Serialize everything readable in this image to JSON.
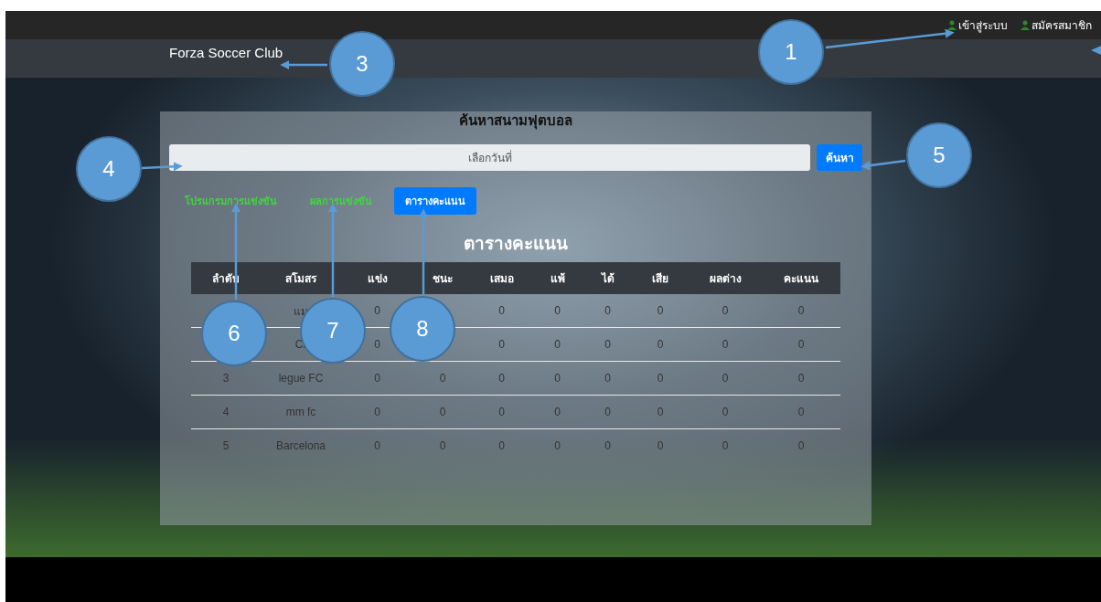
{
  "top_bar": {
    "links": [
      {
        "label": "เข้าสู่ระบบ"
      },
      {
        "label": "สมัครสมาชิก"
      }
    ]
  },
  "navbar": {
    "brand": "Forza Soccer Club"
  },
  "search_panel": {
    "title": "ค้นหาสนามฟุตบอล",
    "date_field": {
      "placeholder": "เลือกวันที่"
    },
    "search_button": "ค้นหา"
  },
  "tabs": [
    {
      "label": "โปรแกรมการแข่งขัน",
      "selected": false
    },
    {
      "label": "ผลการแข่งขัน",
      "selected": false
    },
    {
      "label": "ตารางคะแนน",
      "selected": true
    }
  ],
  "standings": {
    "title": "ตารางคะแนน",
    "columns": [
      "ลำดับ",
      "สโมสร",
      "แข่ง",
      "ชนะ",
      "เสมอ",
      "แพ้",
      "ได้",
      "เสีย",
      "ผลต่าง",
      "คะแนน"
    ],
    "rows": [
      [
        null,
        "แม",
        "0",
        null,
        "0",
        "0",
        "0",
        "0",
        "0",
        "0"
      ],
      [
        null,
        "Cr",
        "0",
        null,
        "0",
        "0",
        "0",
        "0",
        "0",
        "0"
      ],
      [
        "3",
        "legue FC",
        "0",
        "0",
        "0",
        "0",
        "0",
        "0",
        "0",
        "0"
      ],
      [
        "4",
        "mm fc",
        "0",
        "0",
        "0",
        "0",
        "0",
        "0",
        "0",
        "0"
      ],
      [
        "5",
        "Barcelona",
        "0",
        "0",
        "0",
        "0",
        "0",
        "0",
        "0",
        "0"
      ]
    ]
  },
  "callouts": [
    {
      "number": "1"
    },
    {
      "number": "3"
    },
    {
      "number": "4"
    },
    {
      "number": "5"
    },
    {
      "number": "6"
    },
    {
      "number": "7"
    },
    {
      "number": "8"
    }
  ]
}
